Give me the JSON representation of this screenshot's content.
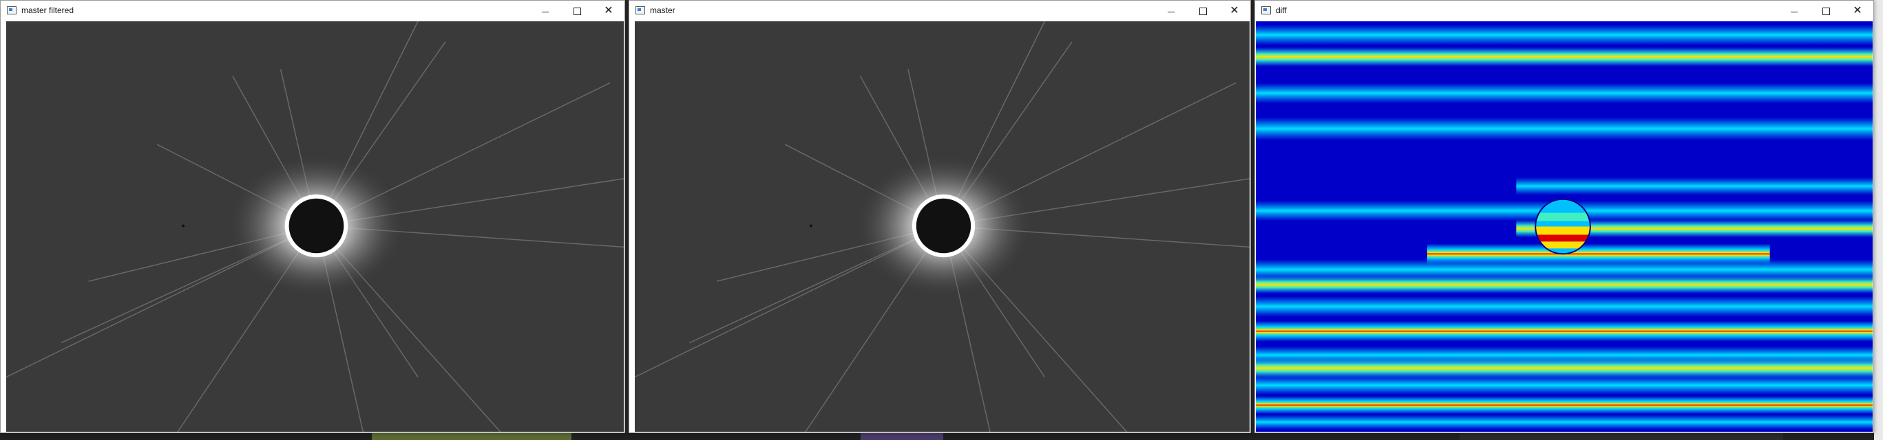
{
  "windows": [
    {
      "title": "master filtered",
      "image": "eclipse-corona-grayscale"
    },
    {
      "title": "master",
      "image": "eclipse-corona-grayscale"
    },
    {
      "title": "diff",
      "image": "difference-heatmap-jet"
    }
  ],
  "controls": {
    "minimize_icon": "minimize-icon",
    "maximize_icon": "maximize-icon",
    "close_icon": "close-icon",
    "close_glyph": "✕"
  },
  "colors": {
    "titlebar": "#ffffff",
    "corona_bg": "#3a3a3a",
    "heatmap_blue": "#0000c8",
    "heatmap_cyan": "#00d8ff",
    "heatmap_yellow": "#ffe000",
    "heatmap_red": "#e00000"
  }
}
